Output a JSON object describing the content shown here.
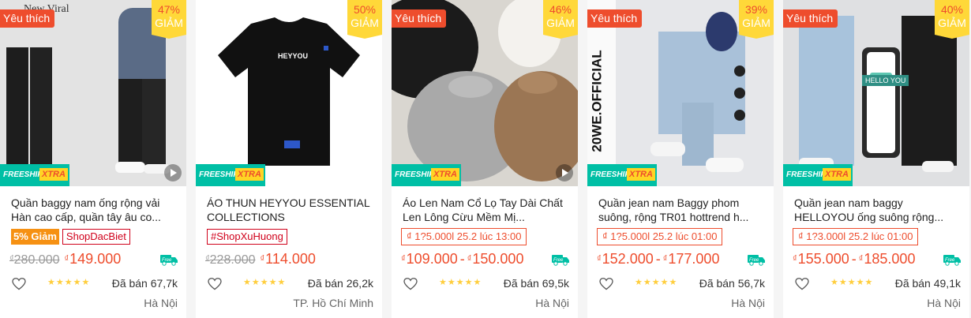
{
  "yeu_thich_label": "Yêu thích",
  "discount_suffix": "GIẢM",
  "freeship_label": "FREESHIP",
  "xtra_label": "XTRA",
  "currency_symbol": "₫",
  "colors": {
    "accent": "#ee4d2d",
    "badge_yellow": "#ffd839",
    "freeship_teal": "#00bfa5"
  },
  "products": [
    {
      "name": "Quần baggy nam ống rộng vải Hàn cao cấp, quần tây âu co...",
      "favorite": true,
      "discount": "47%",
      "image_caption": "New Viral",
      "tags": [
        "5% Giảm",
        "ShopDacBiet"
      ],
      "flash": "",
      "price_old": "280.000",
      "price_min": "149.000",
      "price_max": "",
      "rating": 5,
      "sold": "Đã bán 67,7k",
      "location": "Hà Nội",
      "has_video": true
    },
    {
      "name": "ÁO THUN HEYYOU ESSENTIAL COLLECTIONS",
      "favorite": false,
      "discount": "50%",
      "image_caption": "HEYYOU",
      "tags": [
        "#ShopXuHuong"
      ],
      "flash": "",
      "price_old": "228.000",
      "price_min": "114.000",
      "price_max": "",
      "rating": 5,
      "sold": "Đã bán 26,2k",
      "location": "TP. Hồ Chí Minh",
      "has_video": false
    },
    {
      "name": "Áo Len Nam Cổ Lọ Tay Dài Chất Len Lông Cừu Mềm Mị...",
      "favorite": true,
      "discount": "46%",
      "image_caption": "",
      "tags": [],
      "flash": "₫ 1?5.000l 25.2 lúc 13:00",
      "price_old": "",
      "price_min": "109.000",
      "price_max": "150.000",
      "rating": 5,
      "sold": "Đã bán 69,5k",
      "location": "Hà Nội",
      "has_video": true
    },
    {
      "name": "Quần jean nam Baggy phom suông, rộng TR01 hottrend h...",
      "favorite": true,
      "discount": "39%",
      "image_caption": "20WE.OFFICIAL",
      "tags": [],
      "flash": "₫ 1?5.000l 25.2 lúc 01:00",
      "price_old": "",
      "price_min": "152.000",
      "price_max": "177.000",
      "rating": 5,
      "sold": "Đã bán 56,7k",
      "location": "Hà Nội",
      "has_video": false
    },
    {
      "name": "Quần jean nam baggy HELLOYOU ống suông rộng...",
      "favorite": true,
      "discount": "40%",
      "image_caption": "HELLO YOU",
      "tags": [],
      "flash": "₫ 1?3.000l 25.2 lúc 01:00",
      "price_old": "",
      "price_min": "155.000",
      "price_max": "185.000",
      "rating": 5,
      "sold": "Đã bán 49,1k",
      "location": "Hà Nội",
      "has_video": false
    }
  ]
}
